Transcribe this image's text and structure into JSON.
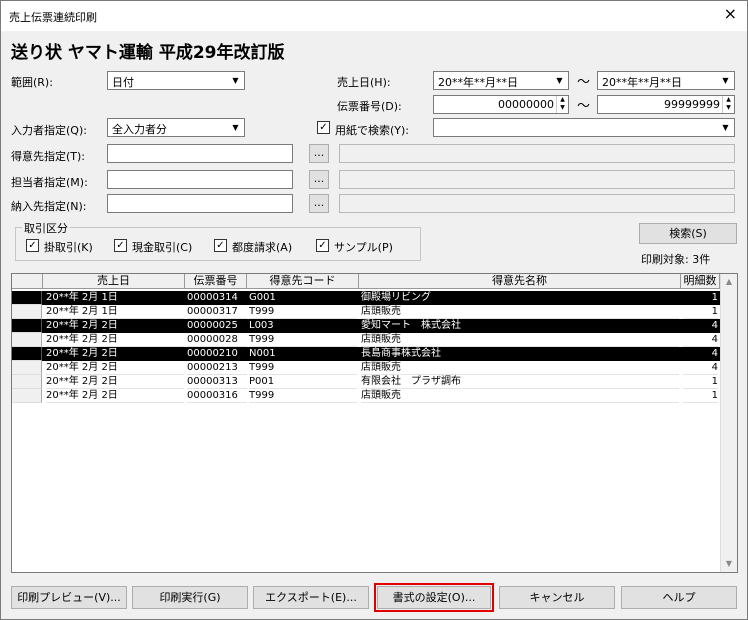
{
  "window": {
    "title": "売上伝票連続印刷",
    "close": "×"
  },
  "heading": "送り状 ヤマト運輸 平成29年改訂版",
  "filters": {
    "range_label": "範囲(R):",
    "range_value": "日付",
    "sales_date_label": "売上日(H):",
    "date_from": "20**年**月**日",
    "date_to": "20**年**月**日",
    "tilde": "～",
    "slip_no_label": "伝票番号(D):",
    "slip_from": "00000000",
    "slip_to": "99999999",
    "input_person_label": "入力者指定(Q):",
    "input_person_value": "全入力者分",
    "paper_search_label": "用紙で検索(Y):",
    "paper_search_value": "",
    "customer_label": "得意先指定(T):",
    "staff_label": "担当者指定(M):",
    "delivery_label": "納入先指定(N):",
    "browse": "..."
  },
  "transaction_type": {
    "title": "取引区分",
    "items": [
      {
        "label": "掛取引(K)",
        "checked": "✓"
      },
      {
        "label": "現金取引(C)",
        "checked": "✓"
      },
      {
        "label": "都度請求(A)",
        "checked": "✓"
      },
      {
        "label": "サンプル(P)",
        "checked": "✓"
      }
    ]
  },
  "search_button": "検索(S)",
  "print_target": "印刷対象: 3件",
  "table": {
    "columns": [
      "売上日",
      "伝票番号",
      "得意先コード",
      "得意先名称",
      "明細数"
    ],
    "rows": [
      {
        "date": "20**年 2月 1日",
        "slip": "00000314",
        "code": "G001",
        "name": "御殿場リビング",
        "count": "1",
        "selected": true
      },
      {
        "date": "20**年 2月 1日",
        "slip": "00000317",
        "code": "T999",
        "name": "店頭販売",
        "count": "1",
        "selected": false
      },
      {
        "date": "20**年 2月 2日",
        "slip": "00000025",
        "code": "L003",
        "name": "愛知マート　株式会社",
        "count": "4",
        "selected": true
      },
      {
        "date": "20**年 2月 2日",
        "slip": "00000028",
        "code": "T999",
        "name": "店頭販売",
        "count": "4",
        "selected": false
      },
      {
        "date": "20**年 2月 2日",
        "slip": "00000210",
        "code": "N001",
        "name": "長島商事株式会社",
        "count": "4",
        "selected": true
      },
      {
        "date": "20**年 2月 2日",
        "slip": "00000213",
        "code": "T999",
        "name": "店頭販売",
        "count": "4",
        "selected": false
      },
      {
        "date": "20**年 2月 2日",
        "slip": "00000313",
        "code": "P001",
        "name": "有限会社　プラザ調布",
        "count": "1",
        "selected": false
      },
      {
        "date": "20**年 2月 2日",
        "slip": "00000316",
        "code": "T999",
        "name": "店頭販売",
        "count": "1",
        "selected": false
      }
    ]
  },
  "buttons": {
    "preview": "印刷プレビュー(V)...",
    "print": "印刷実行(G)",
    "export": "エクスポート(E)...",
    "format": "書式の設定(O)...",
    "cancel": "キャンセル",
    "help": "ヘルプ"
  },
  "colors": {
    "highlight_border": "#e00000",
    "selected_row": "#000000"
  }
}
